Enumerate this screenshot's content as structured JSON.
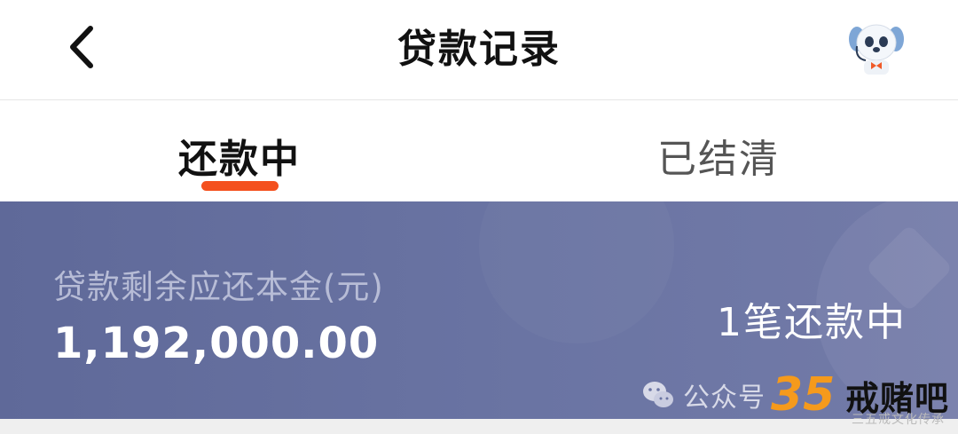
{
  "header": {
    "title": "贷款记录",
    "back_icon": "chevron-left-icon",
    "assistant_icon": "robot-dog-assistant-icon"
  },
  "tabs": [
    {
      "label": "还款中",
      "active": true
    },
    {
      "label": "已结清",
      "active": false
    }
  ],
  "summary": {
    "label": "贷款剩余应还本金(元)",
    "amount": "1,192,000.00",
    "count_text": "1笔还款中"
  },
  "watermark": {
    "prefix": "公众号",
    "badge_number": "35",
    "brand": "戒赌吧",
    "tagline": "三五戒文化传承"
  },
  "colors": {
    "accent": "#f4501e",
    "summary_bg": "#6a74a3",
    "title_text": "#111111"
  }
}
